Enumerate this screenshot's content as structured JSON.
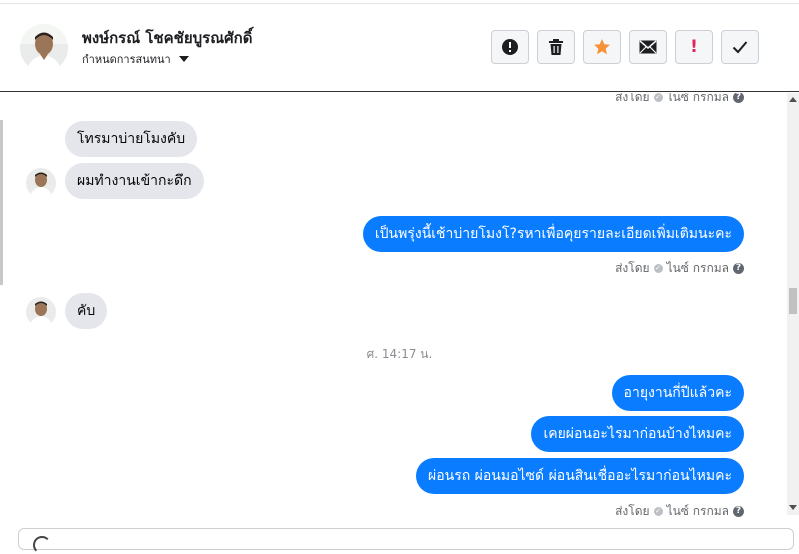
{
  "header": {
    "name": "พงษ์กรณ์ โชคชัยบูรณศักดิ์",
    "subline": "กำหนดการสนทนา",
    "actions": [
      "info-icon",
      "trash-icon",
      "star-icon",
      "mail-icon",
      "exclamation-icon",
      "check-icon"
    ],
    "exclamation_label": "!"
  },
  "messages": {
    "m1": "โทรมาบ่ายโมงคับ",
    "m2": "ผมทำงานเข้ากะดึก",
    "m3": "เป็นพรุ่งนี้เช้าบ่ายโมงโ?รหาเพื่อคุยรายละเอียดเพิ่มเติมนะคะ",
    "m4": "คับ",
    "m5": "อายุงานกี่ปีแล้วคะ",
    "m6": "เคยผ่อนอะไรมาก่อนบ้างไหมคะ",
    "m7": "ผ่อนรถ ผ่อนมอไซด์ ผ่อนสินเชื่ออะไรมาก่อนไหมคะ"
  },
  "status": {
    "sent_by": "ส่งโดย",
    "sender": "ไนซ์ กรกมล"
  },
  "timestamp": "ศ. 14:17 น.",
  "colors": {
    "outgoing": "#0a7cff",
    "incoming": "#e4e6eb",
    "star": "#f7923a",
    "alert": "#e0245e"
  }
}
